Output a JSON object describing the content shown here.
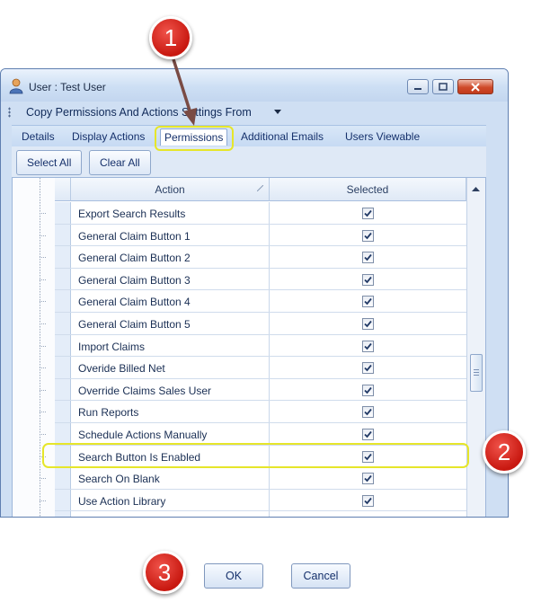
{
  "window": {
    "title": "User : Test User"
  },
  "menu": {
    "copy_label": "Copy Permissions And Actions Settings From"
  },
  "tabs": [
    {
      "label": "Details"
    },
    {
      "label": "Display Actions"
    },
    {
      "label": "Permissions",
      "active": true
    },
    {
      "label": "Additional Emails"
    },
    {
      "label": "Users Viewable"
    }
  ],
  "toolbar": {
    "select_all": "Select All",
    "clear_all": "Clear All"
  },
  "grid": {
    "columns": {
      "action": "Action",
      "selected": "Selected"
    },
    "rows": [
      {
        "action": "Export Search Results",
        "selected": true
      },
      {
        "action": "General Claim Button 1",
        "selected": true
      },
      {
        "action": "General Claim Button 2",
        "selected": true
      },
      {
        "action": "General Claim Button 3",
        "selected": true
      },
      {
        "action": "General Claim Button 4",
        "selected": true
      },
      {
        "action": "General Claim Button 5",
        "selected": true
      },
      {
        "action": "Import Claims",
        "selected": true
      },
      {
        "action": "Overide Billed Net",
        "selected": true
      },
      {
        "action": "Override Claims Sales User",
        "selected": true
      },
      {
        "action": "Run Reports",
        "selected": true
      },
      {
        "action": "Schedule Actions Manually",
        "selected": true
      },
      {
        "action": "Search Button Is Enabled",
        "selected": true
      },
      {
        "action": "Search On Blank",
        "selected": true
      },
      {
        "action": "Use Action Library",
        "selected": true
      },
      {
        "action": "",
        "selected": true
      }
    ]
  },
  "callouts": [
    "1",
    "2",
    "3"
  ],
  "dialog_buttons": {
    "ok": "OK",
    "cancel": "Cancel"
  },
  "colors": {
    "highlight": "#e6e62a",
    "callout": "#c81810"
  }
}
